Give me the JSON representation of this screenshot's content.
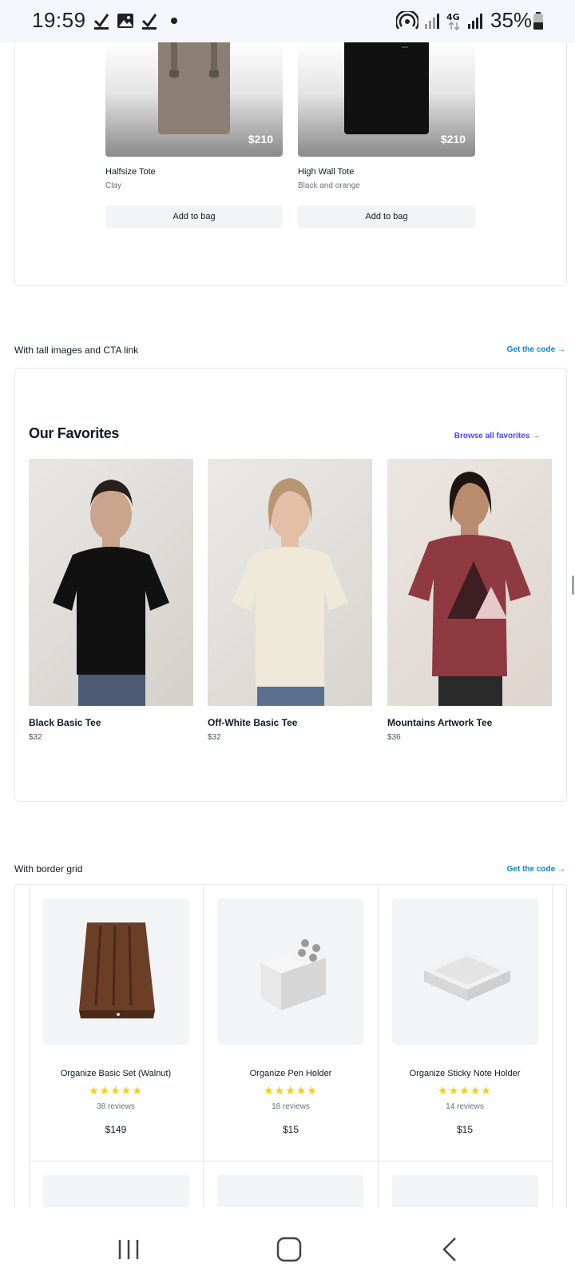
{
  "status_bar": {
    "time": "19:59",
    "battery": "35%",
    "network": "4G",
    "icons": [
      "check-icon",
      "image-icon",
      "check-icon",
      "dot-icon",
      "hotspot-icon",
      "signal-icon",
      "network-4g-icon",
      "signal-icon",
      "battery-icon"
    ]
  },
  "totes": [
    {
      "name": "Halfsize Tote",
      "color": "Clay",
      "price": "$210",
      "button": "Add to bag"
    },
    {
      "name": "High Wall Tote",
      "color": "Black and orange",
      "price": "$210",
      "button": "Add to bag"
    }
  ],
  "tall_section": {
    "label": "With tall images and CTA link",
    "code_link": "Get the code →",
    "title": "Our Favorites",
    "browse_link": "Browse all favorites →",
    "products": [
      {
        "name": "Black Basic Tee",
        "price": "$32"
      },
      {
        "name": "Off-White Basic Tee",
        "price": "$32"
      },
      {
        "name": "Mountains Artwork Tee",
        "price": "$36"
      }
    ]
  },
  "grid_section": {
    "label": "With border grid",
    "code_link": "Get the code →",
    "products": [
      {
        "name": "Organize Basic Set (Walnut)",
        "stars": "★★★★★",
        "reviews": "38 reviews",
        "price": "$149"
      },
      {
        "name": "Organize Pen Holder",
        "stars": "★★★★★",
        "reviews": "18 reviews",
        "price": "$15"
      },
      {
        "name": "Organize Sticky Note Holder",
        "stars": "★★★★★",
        "reviews": "14 reviews",
        "price": "$15"
      }
    ]
  },
  "nav_bar": {
    "icons": [
      "recent-apps-icon",
      "home-icon",
      "back-icon"
    ]
  },
  "colors": {
    "accent_link": "#0b86c4",
    "favorites_link": "#4f46e5",
    "star": "#facc15"
  }
}
